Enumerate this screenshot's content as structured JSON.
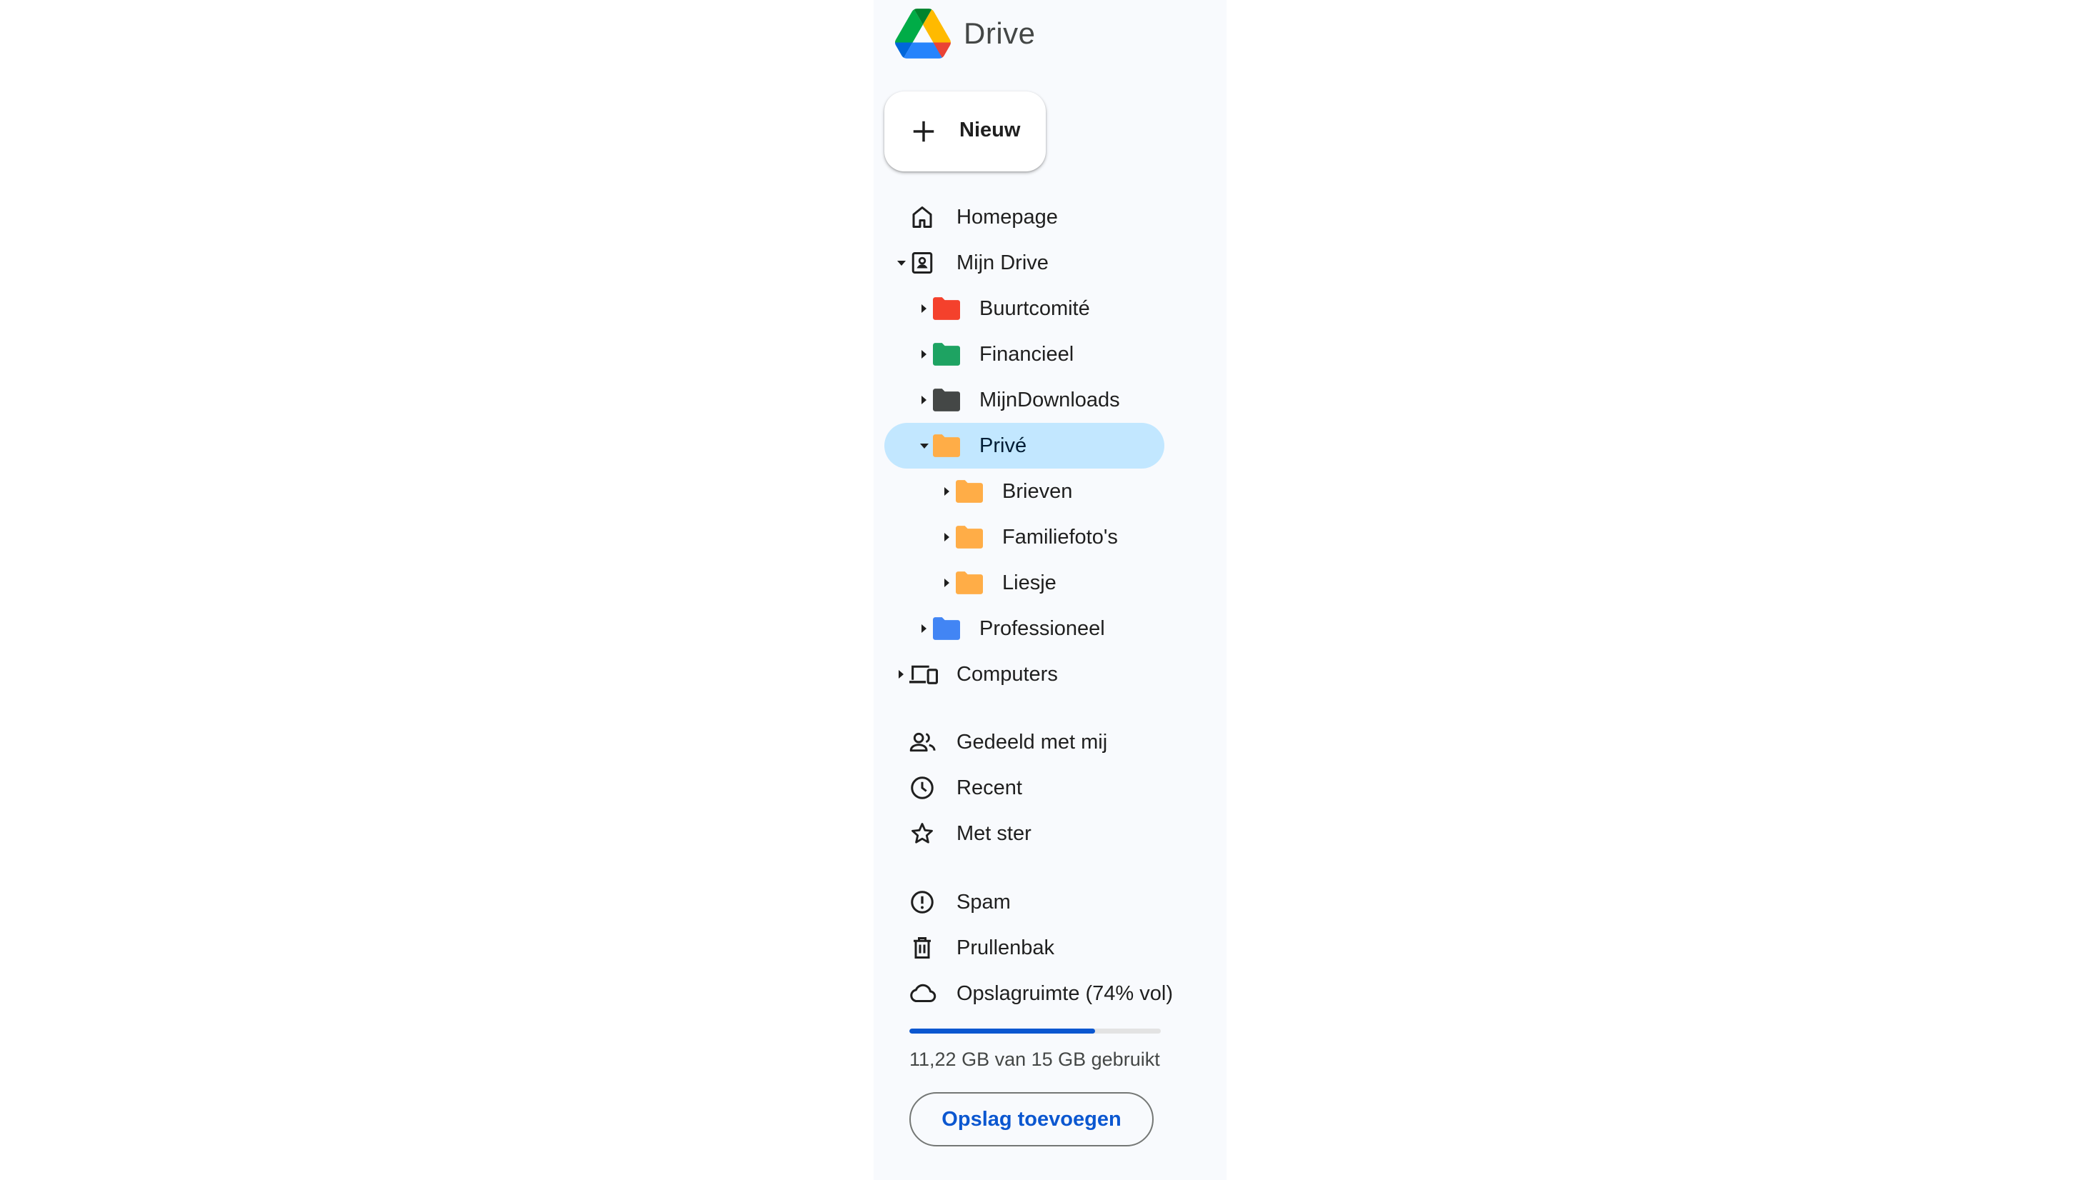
{
  "app": {
    "title": "Drive"
  },
  "new_button": {
    "label": "Nieuw"
  },
  "nav": {
    "homepage": "Homepage",
    "my_drive": "Mijn Drive",
    "folders": [
      {
        "label": "Buurtcomité",
        "color": "#f4412c"
      },
      {
        "label": "Financieel",
        "color": "#1ea362"
      },
      {
        "label": "MijnDownloads",
        "color": "#444746"
      },
      {
        "label": "Privé",
        "color": "#ffad47"
      },
      {
        "label": "Brieven",
        "color": "#ffad47"
      },
      {
        "label": "Familiefoto's",
        "color": "#ffad47"
      },
      {
        "label": "Liesje",
        "color": "#ffad47"
      },
      {
        "label": "Professioneel",
        "color": "#4285f4"
      }
    ],
    "computers": "Computers",
    "shared": "Gedeeld met mij",
    "recent": "Recent",
    "starred": "Met ster",
    "spam": "Spam",
    "trash": "Prullenbak",
    "storage": "Opslagruimte (74% vol)"
  },
  "storage": {
    "used_fraction": 0.74,
    "text": "11,22 GB van 15 GB gebruikt",
    "add_button": "Opslag toevoegen"
  },
  "colors": {
    "accent": "#0b57d0",
    "selected": "#c2e7ff",
    "sidebar": "#f8fafd"
  }
}
